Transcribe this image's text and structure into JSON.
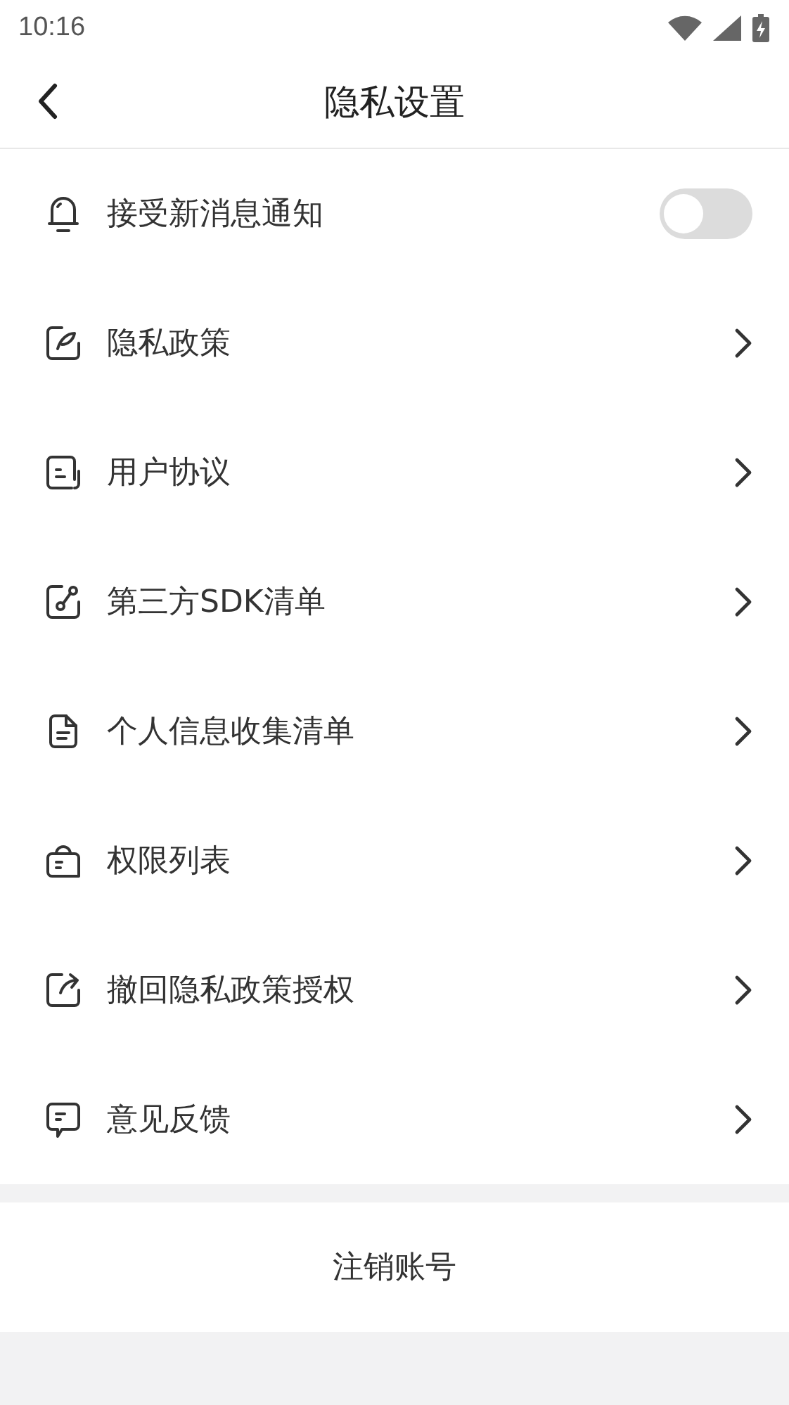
{
  "status_bar": {
    "time": "10:16"
  },
  "header": {
    "title": "隐私设置"
  },
  "items": [
    {
      "kind": "toggle",
      "label": "接受新消息通知",
      "on": false
    },
    {
      "kind": "link",
      "label": "隐私政策"
    },
    {
      "kind": "link",
      "label": "用户协议"
    },
    {
      "kind": "link",
      "label": "第三方SDK清单"
    },
    {
      "kind": "link",
      "label": "个人信息收集清单"
    },
    {
      "kind": "link",
      "label": "权限列表"
    },
    {
      "kind": "link",
      "label": "撤回隐私政策授权"
    },
    {
      "kind": "link",
      "label": "意见反馈"
    }
  ],
  "footer_button": "注销账号"
}
